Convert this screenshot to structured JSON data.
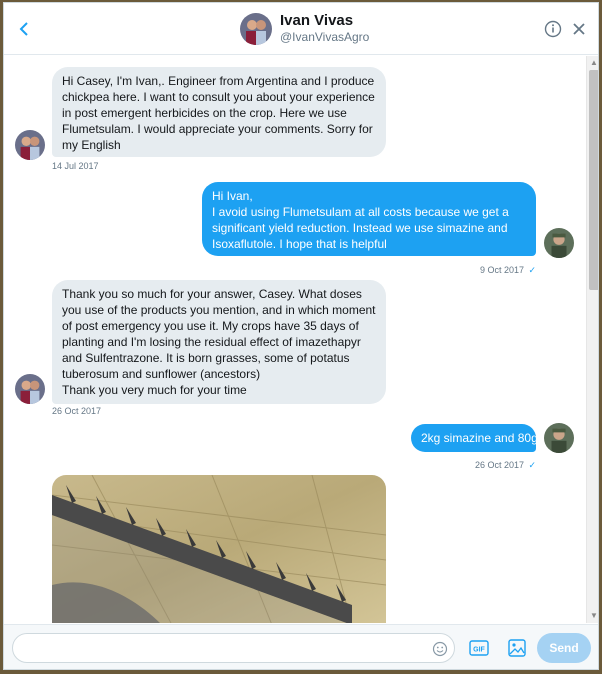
{
  "header": {
    "name": "Ivan Vivas",
    "handle": "@IvanVivasAgro",
    "back_icon": "chevron-left-icon",
    "info_icon": "info-icon",
    "close_icon": "close-icon"
  },
  "messages": [
    {
      "direction": "incoming",
      "text": "Hi Casey, I'm Ivan,. Engineer from Argentina and I produce chickpea here. I want to consult you about your experience in post emergent herbicides on the crop. Here we use Flumetsulam. I would appreciate your comments. Sorry for my English",
      "timestamp": "14 Jul 2017"
    },
    {
      "direction": "outgoing",
      "text": "Hi Ivan,\nI avoid using Flumetsulam at all costs because we get a significant yield reduction. Instead we use simazine and Isoxaflutole. I hope that is helpful",
      "timestamp": "9 Oct 2017"
    },
    {
      "direction": "incoming",
      "text": "Thank you so much for your answer, Casey. What doses you use of the products you mention, and in which moment of post emergency you use it. My crops have 35 days of planting and I'm losing the residual effect of imazethapyr and Sulfentrazone. It is born grasses, some of potatus tuberosum and sunflower (ancestors)\nThank you very much for your time",
      "timestamp": "26 Oct 2017"
    },
    {
      "direction": "outgoing",
      "text": "2kg simazine and 80g",
      "timestamp": "26 Oct 2017"
    }
  ],
  "composer": {
    "placeholder": "",
    "send_label": "Send",
    "gif_label": "GIF"
  },
  "colors": {
    "accent": "#1da1f2",
    "incoming_bubble": "#e6ecf0",
    "send_disabled": "#a5d2f3"
  }
}
